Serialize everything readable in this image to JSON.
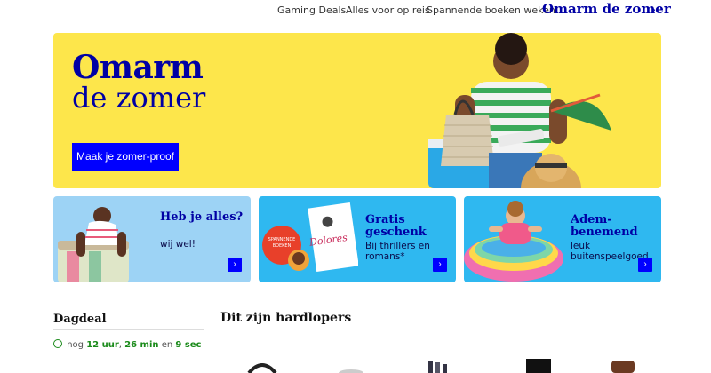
{
  "topnav": {
    "items": [
      "Gaming Deals",
      "Alles voor op reis",
      "Spannende boeken weken"
    ],
    "active": "Omarm de zomer"
  },
  "hero": {
    "title_line1": "Omarm",
    "title_line2": "de zomer",
    "button": "Maak je zomer-proof",
    "background": "#fde64b"
  },
  "cards": [
    {
      "title": "Heb je alles?",
      "subtitle": "wij wel!"
    },
    {
      "title": "Gratis\ngeschenk",
      "subtitle": "Bij thrillers en romans*",
      "badge": "SPANNENDE BOEKEN WEKEN",
      "book_title": "Dolores"
    },
    {
      "title": "Adem-\nbenemend",
      "subtitle": "leuk buitenspeelgoed"
    }
  ],
  "dagdeal": {
    "title": "Dagdeal",
    "prefix": "nog",
    "hours": "12 uur",
    "minutes": "26 min",
    "and": "en",
    "seconds": "9 sec"
  },
  "section": {
    "title": "Dit zijn hardlopers"
  },
  "colors": {
    "brand_blue": "#0000a4",
    "button_blue": "#0000ff",
    "yellow": "#fde64b",
    "sky": "#2fb8f0"
  }
}
